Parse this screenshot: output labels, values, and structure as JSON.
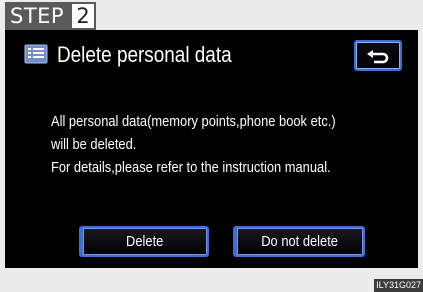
{
  "step": {
    "label": "STEP",
    "number": "2"
  },
  "screen": {
    "title": "Delete personal data",
    "title_icon": "document-list-icon",
    "back_icon": "return-arrow-icon",
    "message_lines": [
      "All personal data(memory points,phone book etc.)",
      "will be deleted.",
      "For details,please refer to the instruction manual."
    ],
    "buttons": {
      "delete": "Delete",
      "do_not_delete": "Do not delete"
    }
  },
  "image_code": "ILY31G027",
  "colors": {
    "screen_bg": "#000000",
    "button_border": "#3b6fd4",
    "step_bg": "#5a5a5a",
    "page_bg": "#ececec"
  }
}
